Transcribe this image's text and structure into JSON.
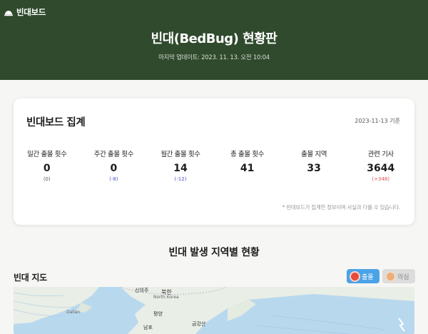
{
  "header": {
    "brand": "빈대보드",
    "title": "빈대(BedBug) 현황판",
    "updated": "마지막 업데이트: 2023. 11. 13. 오전 10:04"
  },
  "summary": {
    "title": "빈대보드 집계",
    "date": "2023-11-13 기준",
    "stats": [
      {
        "label": "일간 출몰 횟수",
        "value": "0",
        "change": "(0)"
      },
      {
        "label": "주간 출몰 횟수",
        "value": "0",
        "change": "(-8)"
      },
      {
        "label": "월간 출몰 횟수",
        "value": "14",
        "change": "(-12)"
      },
      {
        "label": "총 출몰 횟수",
        "value": "41",
        "change": ""
      },
      {
        "label": "출몰 지역",
        "value": "33",
        "change": ""
      },
      {
        "label": "관련 기사",
        "value": "3644",
        "change": "(+348)"
      }
    ],
    "note": "* 빈대보드가 집계한 정보이며 사실과 다를 수 있습니다."
  },
  "section": {
    "title": "빈대 발생 지역별 현황"
  },
  "map": {
    "label": "빈대 지도",
    "toggles": {
      "outbreak": "출몰",
      "suspect": "의심"
    },
    "places": {
      "north_korea": "북한",
      "north_korea_en": "North Korea",
      "pyongyang": "평양",
      "nampo": "남포",
      "geumgang": "금강산",
      "dalian": "Dalian",
      "sinuiju": "신의주"
    }
  },
  "colors": {
    "header_bg": "#2f4a2c",
    "map_water": "#b8d8ee",
    "map_land": "#e9eee6",
    "outbreak_toggle": "#4aa3e6",
    "decrease": "#4a52c9",
    "increase": "#d9534f"
  },
  "icons": {
    "brand": "dome-icon",
    "outbreak": "bug-icon",
    "suspect": "bug-icon"
  }
}
